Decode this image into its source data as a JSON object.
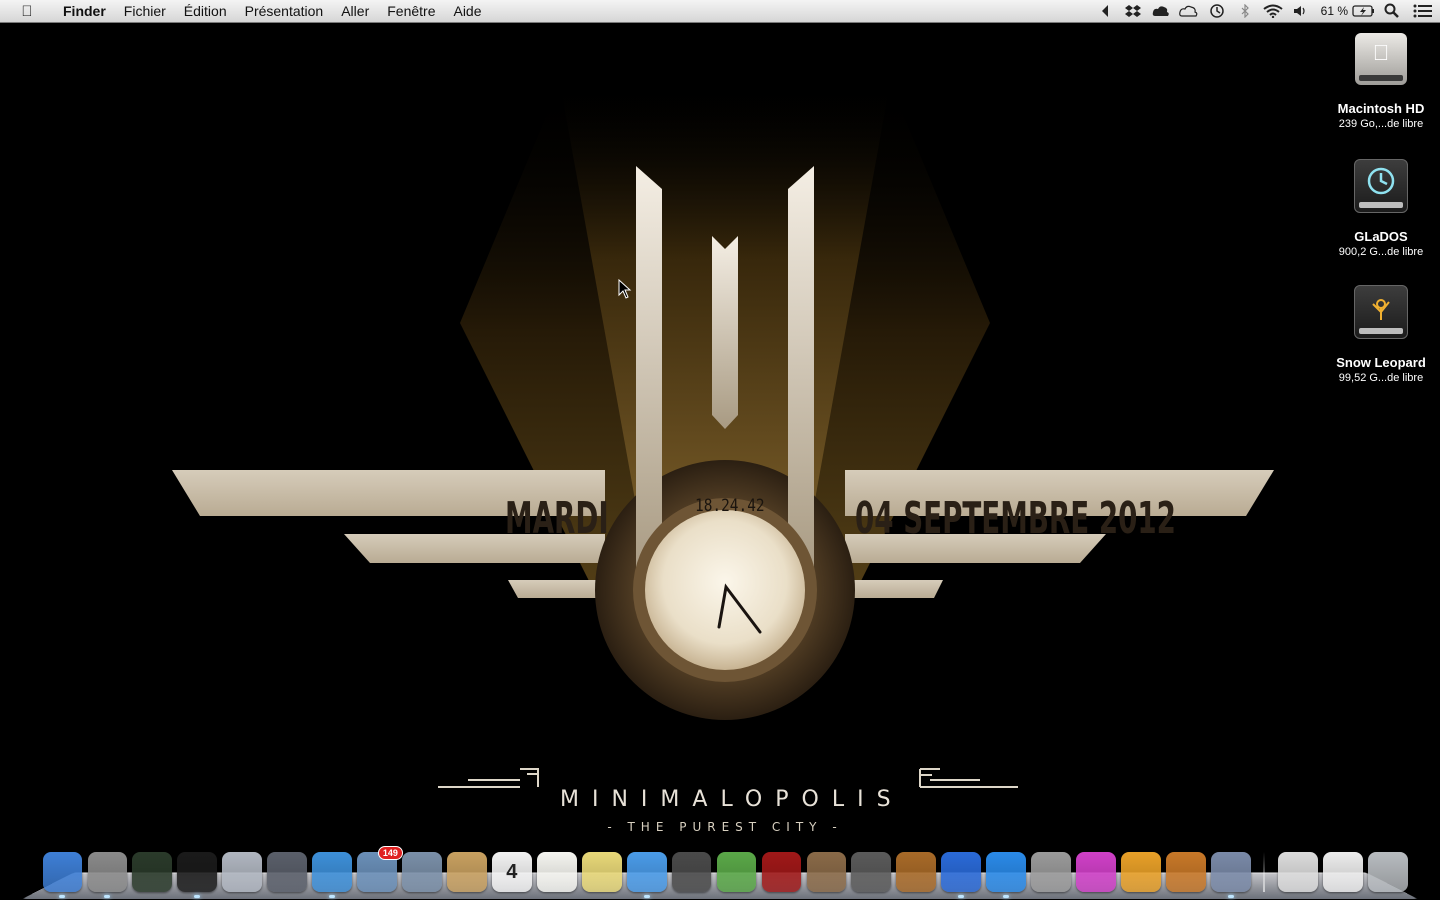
{
  "menubar": {
    "app_name": "Finder",
    "menus": [
      "Fichier",
      "Édition",
      "Présentation",
      "Aller",
      "Fenêtre",
      "Aide"
    ],
    "battery_percent": "61 %",
    "status_icons": [
      "back-arrow-icon",
      "dropbox-icon",
      "cloud-app-icon",
      "icloud-icon",
      "time-machine-icon",
      "bluetooth-icon",
      "wifi-icon",
      "volume-icon",
      "battery-icon",
      "spotlight-icon",
      "notification-center-icon"
    ]
  },
  "wallpaper": {
    "day": "MARDI",
    "time": "18.24.42",
    "date": "04 SEPTEMBRE 2012",
    "brand": "MINIMALOPOLIS",
    "tagline": "- THE PUREST CITY -"
  },
  "drives": [
    {
      "name": "Macintosh HD",
      "free": "239 Go,...de libre",
      "icon": "internal-disk-icon"
    },
    {
      "name": "GLaDOS",
      "free": "900,2 G...de libre",
      "icon": "time-machine-disk-icon"
    },
    {
      "name": "Snow Leopard",
      "free": "99,52 G...de libre",
      "icon": "firewire-disk-icon"
    }
  ],
  "dock": {
    "apps": [
      {
        "id": "finder",
        "color": "#3e7fd6"
      },
      {
        "id": "system-preferences",
        "color": "#8a8a8a"
      },
      {
        "id": "activity-monitor",
        "color": "#2a3a2a"
      },
      {
        "id": "terminal",
        "color": "#1a1a1a"
      },
      {
        "id": "launchpad",
        "color": "#b0b6c0"
      },
      {
        "id": "mission-control",
        "color": "#5a5f6a"
      },
      {
        "id": "safari",
        "color": "#3d8fd8"
      },
      {
        "id": "mail",
        "color": "#6a8fb8",
        "badge": "149"
      },
      {
        "id": "image-capture",
        "color": "#7a8fa8"
      },
      {
        "id": "contacts",
        "color": "#c8a060"
      },
      {
        "id": "calendar",
        "color": "#f2f2f2",
        "label": "4"
      },
      {
        "id": "reminders",
        "color": "#f5f5f0"
      },
      {
        "id": "notes",
        "color": "#e8d878"
      },
      {
        "id": "messages",
        "color": "#4a9be8"
      },
      {
        "id": "facetime",
        "color": "#4a4a4a"
      },
      {
        "id": "game-center",
        "color": "#5aa848"
      },
      {
        "id": "photo-booth",
        "color": "#a01818"
      },
      {
        "id": "iphoto",
        "color": "#8a6a48"
      },
      {
        "id": "imovie",
        "color": "#5a5a5a"
      },
      {
        "id": "garageband",
        "color": "#a86a28"
      },
      {
        "id": "itunes",
        "color": "#2a6ad8"
      },
      {
        "id": "app-store",
        "color": "#2a8ae8"
      },
      {
        "id": "latexit",
        "color": "#9a9a9a"
      },
      {
        "id": "flower-app",
        "color": "#d040c8"
      },
      {
        "id": "sublime-text",
        "color": "#e8a028"
      },
      {
        "id": "x11",
        "color": "#c87828"
      },
      {
        "id": "preview",
        "color": "#7a8aa8"
      }
    ],
    "stacks": [
      {
        "id": "documents-stack",
        "color": "#dcdcdc"
      },
      {
        "id": "downloads-stack",
        "color": "#ececec"
      },
      {
        "id": "trash",
        "color": "#b8bcc0"
      }
    ]
  }
}
